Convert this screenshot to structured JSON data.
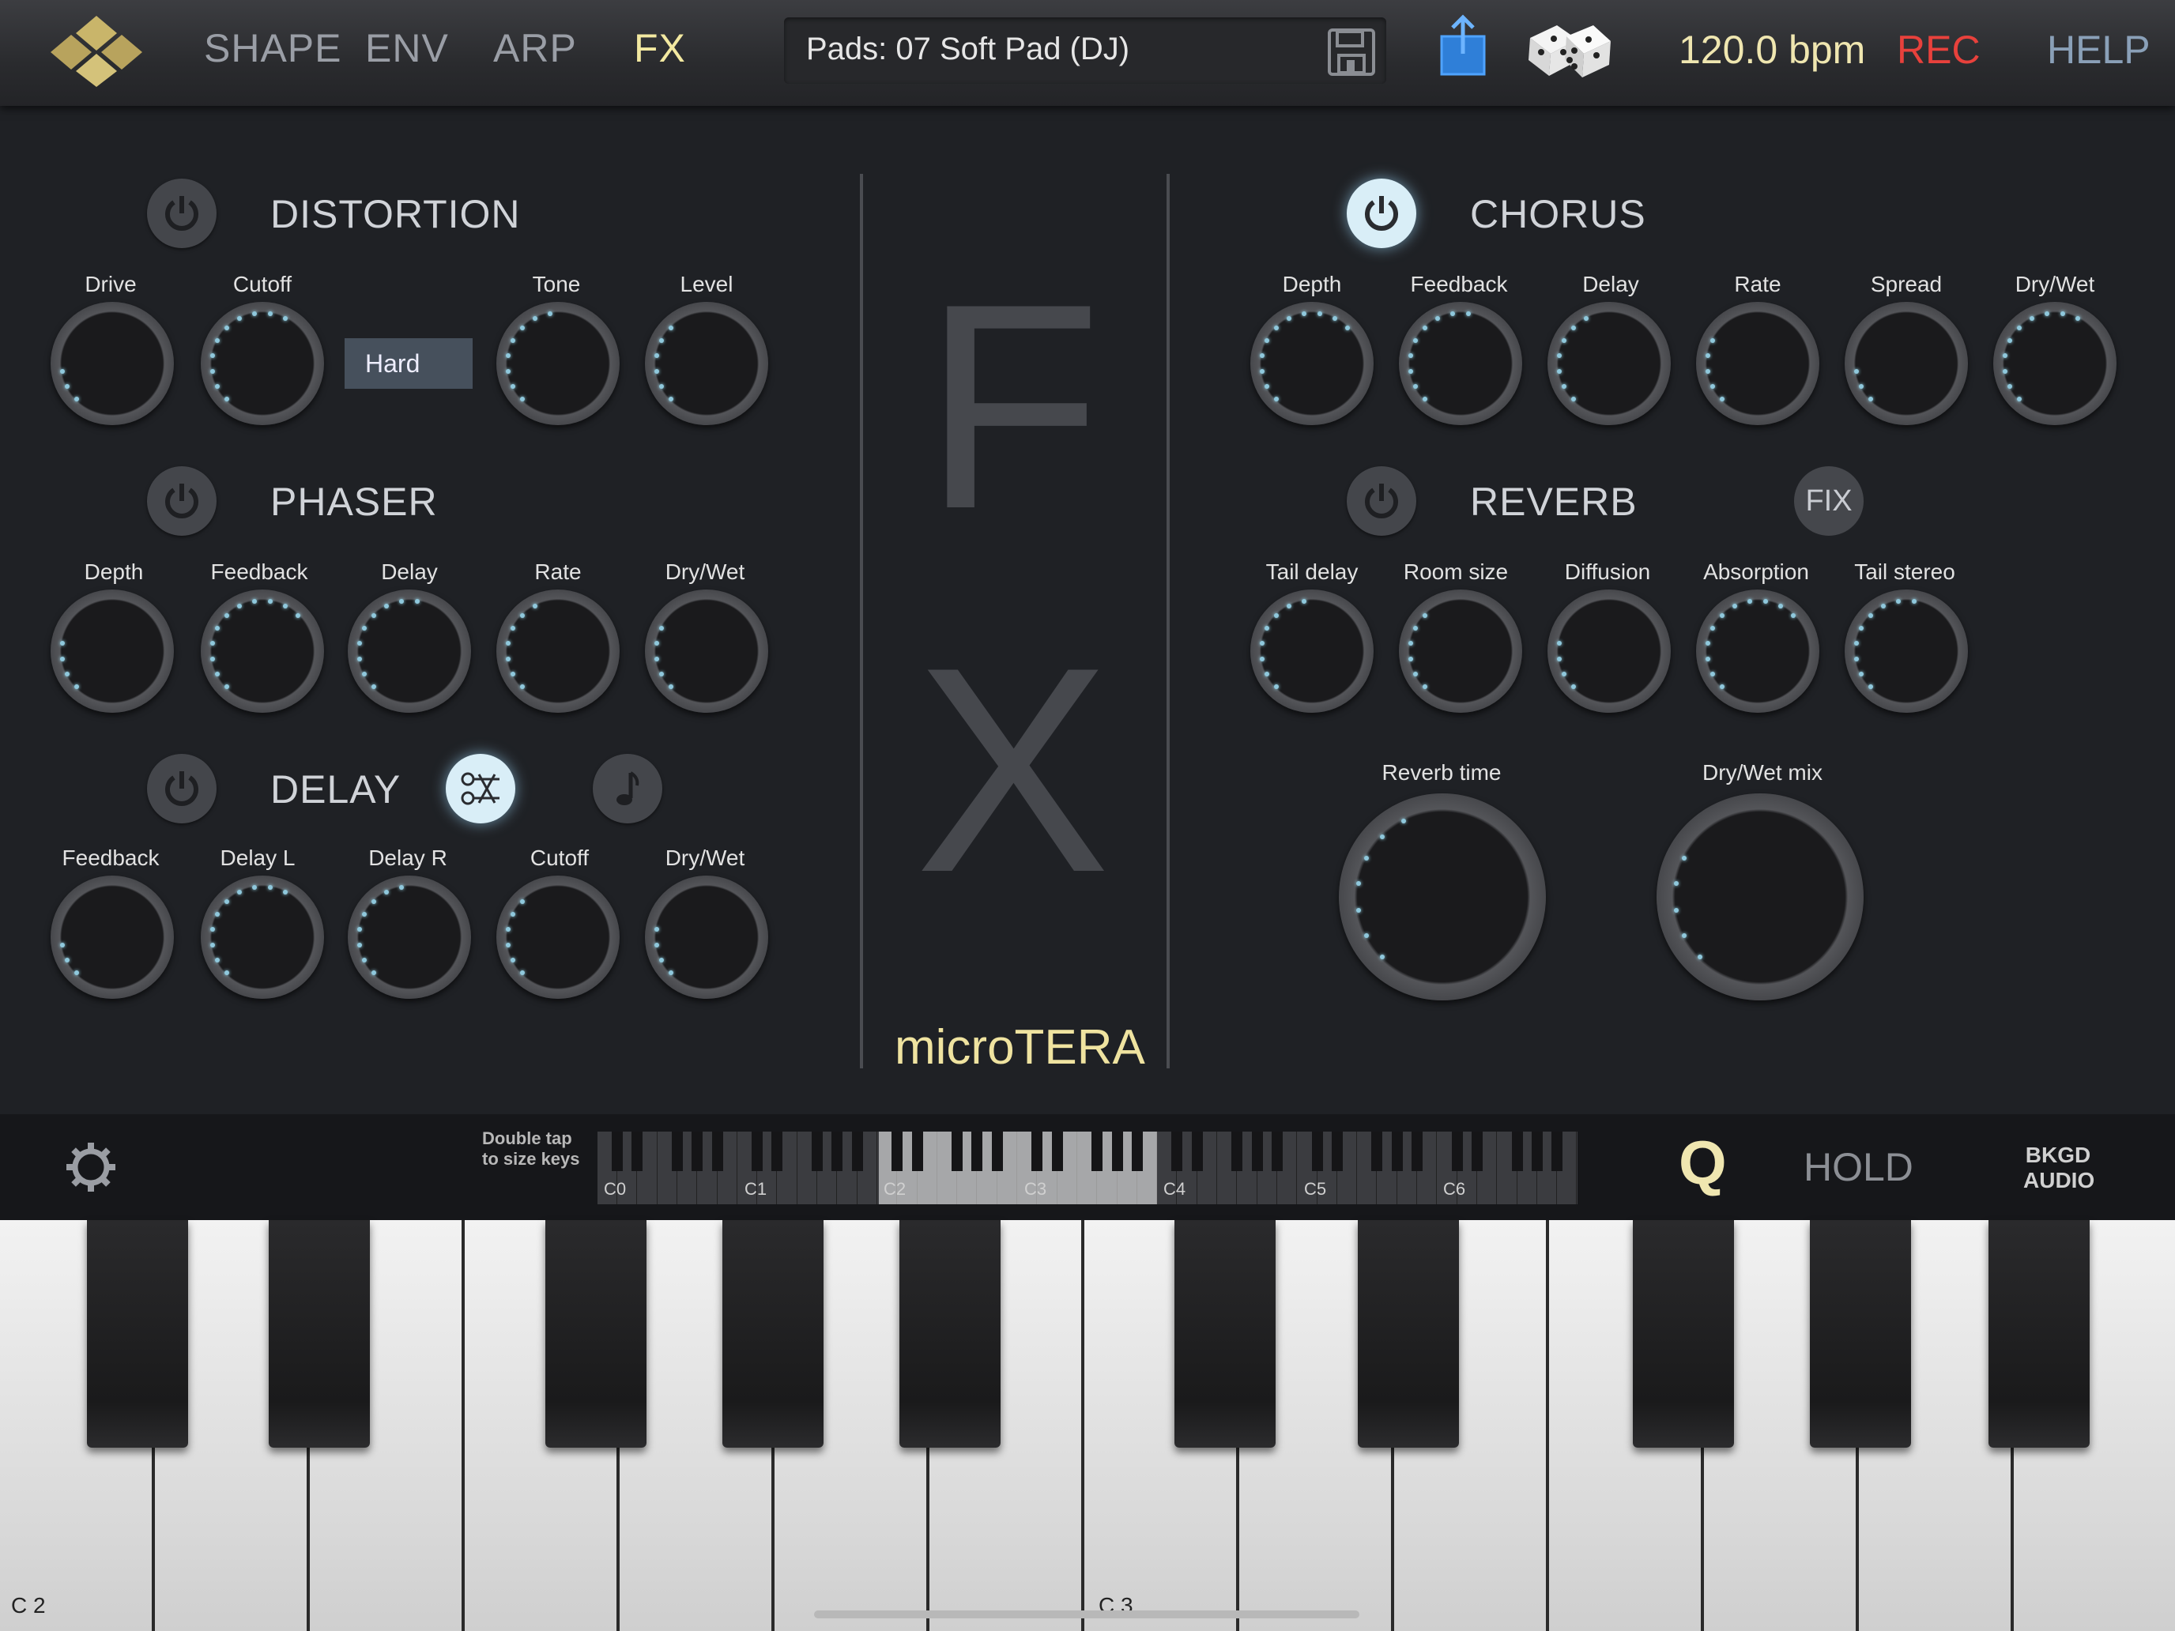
{
  "nav": {
    "tabs": [
      "SHAPE",
      "ENV",
      "ARP",
      "FX"
    ],
    "active_tab": "FX"
  },
  "preset": {
    "name": "Pads: 07 Soft Pad (DJ)"
  },
  "transport": {
    "bpm": "120.0 bpm",
    "rec": "REC",
    "help": "HELP"
  },
  "icons": {
    "logo": "logo-icon",
    "save": "save-icon",
    "share": "share-icon",
    "random": "dice-icon",
    "settings": "gear-icon"
  },
  "distortion": {
    "title": "DISTORTION",
    "enabled": false,
    "mode": "Hard",
    "knobs": [
      "Drive",
      "Cutoff",
      "Tone",
      "Level"
    ]
  },
  "phaser": {
    "title": "PHASER",
    "enabled": false,
    "knobs": [
      "Depth",
      "Feedback",
      "Delay",
      "Rate",
      "Dry/Wet"
    ]
  },
  "delay": {
    "title": "DELAY",
    "enabled": false,
    "knobs": [
      "Feedback",
      "Delay L",
      "Delay R",
      "Cutoff",
      "Dry/Wet"
    ]
  },
  "chorus": {
    "title": "CHORUS",
    "enabled": true,
    "knobs": [
      "Depth",
      "Feedback",
      "Delay",
      "Rate",
      "Spread",
      "Dry/Wet"
    ]
  },
  "reverb": {
    "title": "REVERB",
    "enabled": false,
    "fix_label": "FIX",
    "knobs": [
      "Tail delay",
      "Room size",
      "Diffusion",
      "Absorption",
      "Tail stereo"
    ],
    "big_knobs": [
      "Reverb time",
      "Dry/Wet mix"
    ]
  },
  "center": {
    "letter_f": "F",
    "letter_x": "X",
    "brand": "microTERA"
  },
  "keyboard_bar": {
    "hint_line1": "Double tap",
    "hint_line2": "to size keys",
    "octaves": [
      "C0",
      "C1",
      "C2",
      "C3",
      "C4",
      "C5",
      "C6"
    ],
    "q_label": "Q",
    "hold_label": "HOLD",
    "bkgd_line1": "BKGD",
    "bkgd_line2": "AUDIO"
  },
  "piano": {
    "left_label": "C 2",
    "mid_label": "C 3"
  },
  "colors": {
    "accent": "#efe6b0",
    "rec": "#e8413c",
    "help": "#8aa0b8",
    "knob_dot": "#8fc8dc",
    "power_on": "#d9eef7"
  }
}
